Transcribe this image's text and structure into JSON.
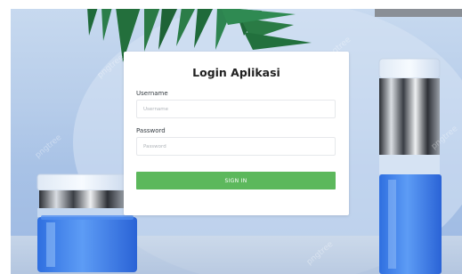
{
  "login": {
    "title": "Login Aplikasi",
    "username_label": "Username",
    "username_placeholder": "Username",
    "username_value": "",
    "password_label": "Password",
    "password_placeholder": "Password",
    "password_value": "",
    "submit_label": "SIGN IN"
  },
  "background": {
    "watermark_text": "pngtree"
  },
  "colors": {
    "button": "#5cb85c",
    "card": "#ffffff",
    "backdrop": "#b7cdea"
  }
}
